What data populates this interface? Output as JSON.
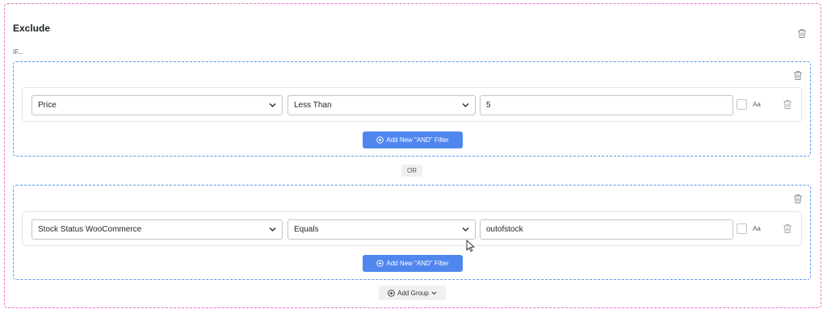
{
  "section": {
    "title": "Exclude",
    "if_label": "IF..."
  },
  "groups": [
    {
      "rows": [
        {
          "field": "Price",
          "operator": "Less Than",
          "value": "5",
          "case_label": "Aa"
        }
      ],
      "add_and_label": "Add New \"AND\" Filter"
    },
    {
      "rows": [
        {
          "field": "Stock Status WooCommerce",
          "operator": "Equals",
          "value": "outofstock",
          "case_label": "Aa"
        }
      ],
      "add_and_label": "Add New \"AND\" Filter"
    }
  ],
  "or_label": "OR",
  "add_group_label": "Add Group",
  "colors": {
    "outer_border": "#f06ec3",
    "group_border": "#5b9bea",
    "primary_button": "#4f87ef"
  },
  "icons": [
    "trash-icon",
    "chevron-down-icon",
    "plus-circle-icon",
    "mouse-cursor-icon"
  ]
}
